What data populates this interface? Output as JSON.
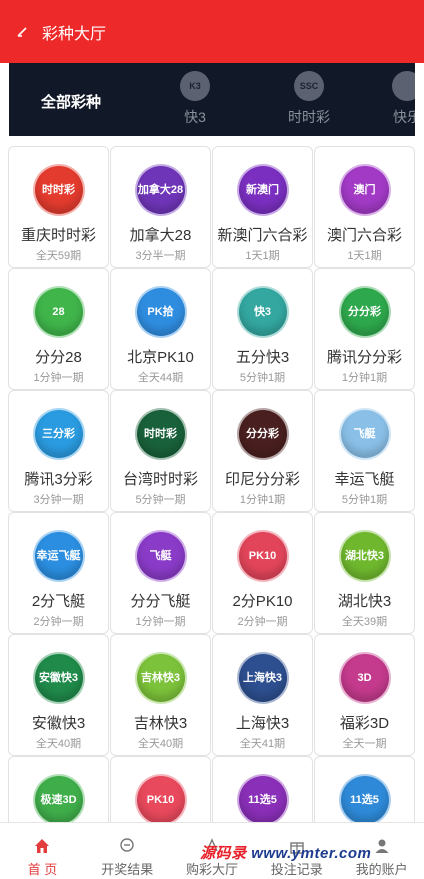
{
  "header": {
    "title": "彩种大厅"
  },
  "tabs": {
    "all_label": "全部彩种",
    "items": [
      {
        "label": "快3",
        "icon": "k3-icon"
      },
      {
        "label": "时时彩",
        "icon": "ssc-icon"
      },
      {
        "label": "快乐",
        "icon": "kl-icon"
      }
    ]
  },
  "games": [
    {
      "name": "重庆时时彩",
      "freq": "全天59期",
      "logo": "时时彩",
      "color": "#e33b2e"
    },
    {
      "name": "加拿大28",
      "freq": "3分半一期",
      "logo": "加拿大28",
      "color": "#6f35b8"
    },
    {
      "name": "新澳门六合彩",
      "freq": "1天1期",
      "logo": "新澳门",
      "color": "#7a2fc0"
    },
    {
      "name": "澳门六合彩",
      "freq": "1天1期",
      "logo": "澳门",
      "color": "#a23ac6"
    },
    {
      "name": "分分28",
      "freq": "1分钟一期",
      "logo": "28",
      "color": "#3fb54a"
    },
    {
      "name": "北京PK10",
      "freq": "全天44期",
      "logo": "PK拾",
      "color": "#2f8de0"
    },
    {
      "name": "五分快3",
      "freq": "5分钟1期",
      "logo": "快3",
      "color": "#33a7a0"
    },
    {
      "name": "腾讯分分彩",
      "freq": "1分钟1期",
      "logo": "分分彩",
      "color": "#2ea84c"
    },
    {
      "name": "腾讯3分彩",
      "freq": "3分钟一期",
      "logo": "三分彩",
      "color": "#2a9be0"
    },
    {
      "name": "台湾时时彩",
      "freq": "5分钟一期",
      "logo": "时时彩",
      "color": "#19613a"
    },
    {
      "name": "印尼分分彩",
      "freq": "1分钟1期",
      "logo": "分分彩",
      "color": "#4a1f1f"
    },
    {
      "name": "幸运飞艇",
      "freq": "5分钟1期",
      "logo": "飞艇",
      "color": "#8ac0e8"
    },
    {
      "name": "2分飞艇",
      "freq": "2分钟一期",
      "logo": "幸运飞艇",
      "color": "#2b8ee0"
    },
    {
      "name": "分分飞艇",
      "freq": "1分钟一期",
      "logo": "飞艇",
      "color": "#8a3bc8"
    },
    {
      "name": "2分PK10",
      "freq": "2分钟一期",
      "logo": "PK10",
      "color": "#e2455a"
    },
    {
      "name": "湖北快3",
      "freq": "全天39期",
      "logo": "湖北快3",
      "color": "#6fb82e"
    },
    {
      "name": "安徽快3",
      "freq": "全天40期",
      "logo": "安徽快3",
      "color": "#1f8a4a"
    },
    {
      "name": "吉林快3",
      "freq": "全天40期",
      "logo": "吉林快3",
      "color": "#7cc23a"
    },
    {
      "name": "上海快3",
      "freq": "全天41期",
      "logo": "上海快3",
      "color": "#2d4f8f"
    },
    {
      "name": "福彩3D",
      "freq": "全天一期",
      "logo": "3D",
      "color": "#c43a8c"
    },
    {
      "name": "",
      "freq": "",
      "logo": "极速3D",
      "color": "#3fae4a"
    },
    {
      "name": "",
      "freq": "",
      "logo": "PK10",
      "color": "#e8495c"
    },
    {
      "name": "",
      "freq": "",
      "logo": "11选5",
      "color": "#8a2fb8"
    },
    {
      "name": "",
      "freq": "",
      "logo": "11选5",
      "color": "#2e8ad8"
    }
  ],
  "bottom_nav": [
    {
      "label": "首 页",
      "icon": "home-icon",
      "active": true
    },
    {
      "label": "开奖结果",
      "icon": "trophy-icon",
      "active": false
    },
    {
      "label": "购彩大厅",
      "icon": "lottery-icon",
      "active": false
    },
    {
      "label": "投注记录",
      "icon": "gift-icon",
      "active": false
    },
    {
      "label": "我的账户",
      "icon": "user-icon",
      "active": false
    }
  ],
  "watermark": {
    "brand": "源码录",
    "url": "www.ymter.com"
  }
}
